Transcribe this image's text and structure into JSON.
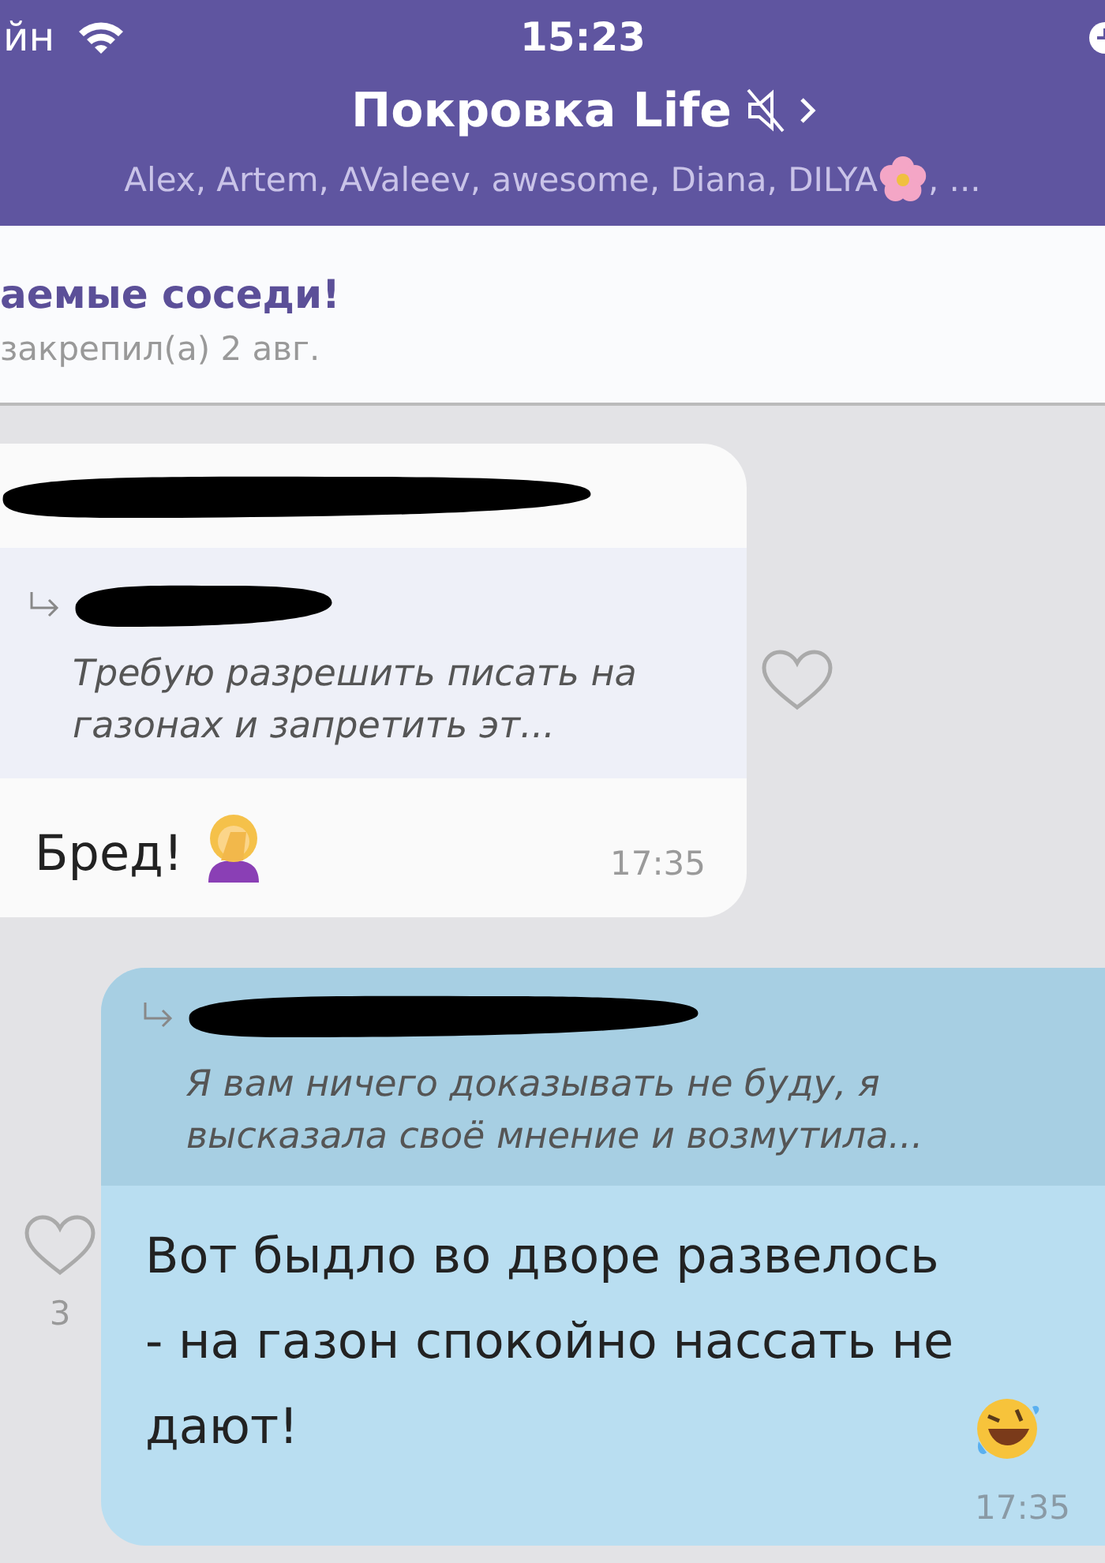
{
  "status_bar": {
    "carrier": "йн",
    "time": "15:23"
  },
  "header": {
    "title": "Покровка Life",
    "muted": true,
    "members": "Alex, Artem, AValeev, awesome, Diana, DILYA",
    "members_more": ", ..."
  },
  "pinned": {
    "title": "аемые соседи!",
    "note": "закрепил(а) 2 авг."
  },
  "messages": [
    {
      "outgoing": false,
      "sender_redacted": true,
      "reply": {
        "author_redacted": true,
        "text": "Требую разрешить писать на газонах и запретить эт..."
      },
      "text": "Бред!",
      "emoji": {
        "kind": "facepalm"
      },
      "time": "17:35",
      "liked": false
    },
    {
      "outgoing": true,
      "sender_redacted": false,
      "reply": {
        "author_redacted": true,
        "text": "Я вам ничего доказывать не буду, я высказала своё мнение и возмутила..."
      },
      "text": "Вот быдло во дворе развелось - на газон спокойно нассать не дают!",
      "emoji": {
        "kind": "laughing"
      },
      "time": "17:35",
      "liked": false,
      "like_count": "3"
    }
  ]
}
